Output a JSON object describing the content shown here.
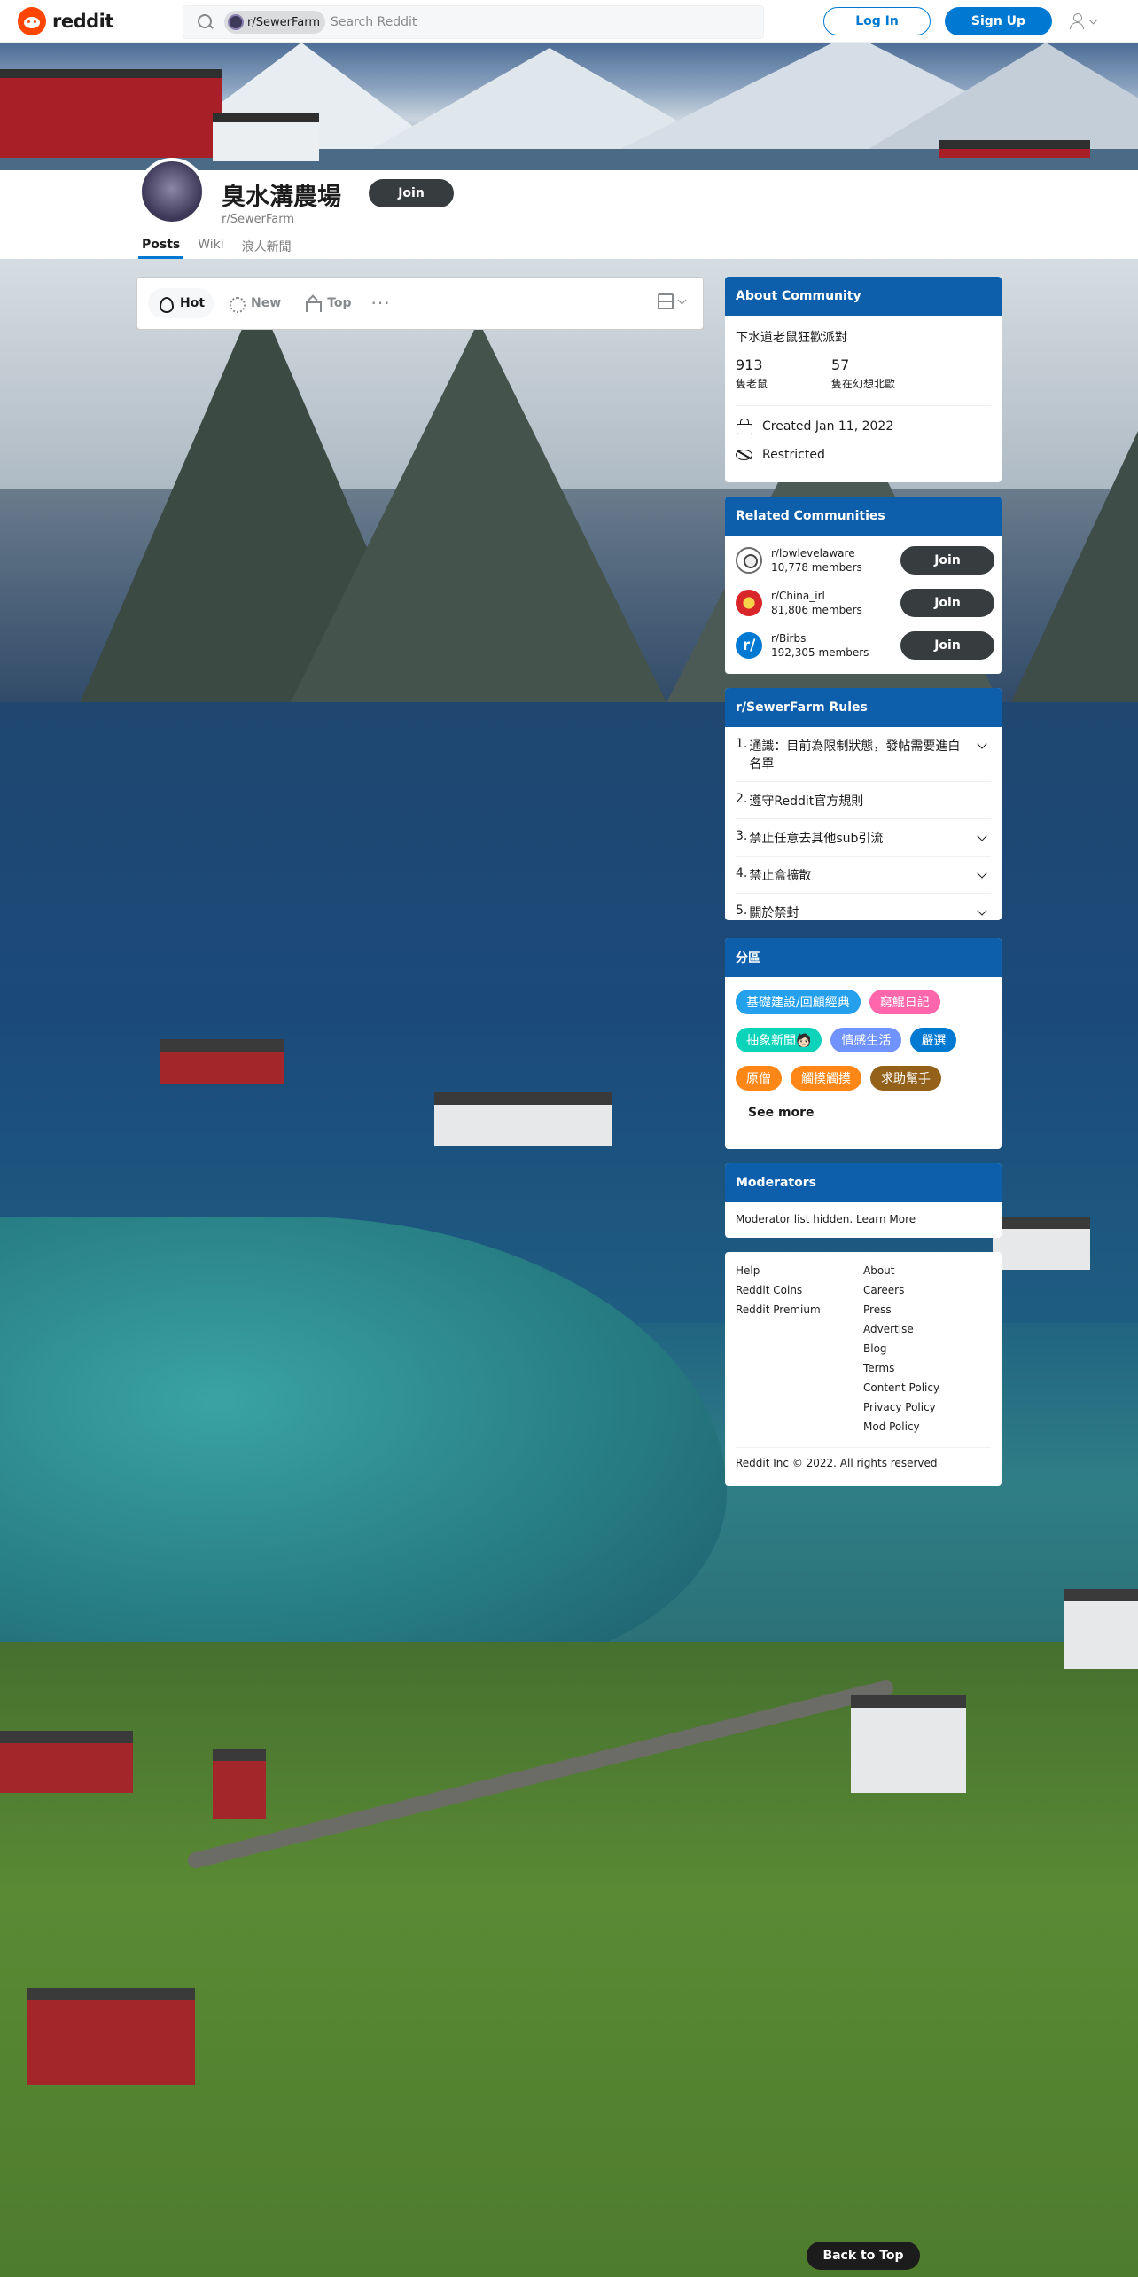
{
  "header": {
    "logo_text": "reddit",
    "search_chip": "r/SewerFarm",
    "search_placeholder": "Search Reddit",
    "login_label": "Log In",
    "signup_label": "Sign Up"
  },
  "community": {
    "title": "臭水溝農場",
    "subtitle": "r/SewerFarm",
    "join_label": "Join",
    "tabs": [
      {
        "label": "Posts",
        "active": true
      },
      {
        "label": "Wiki",
        "active": false
      },
      {
        "label": "浪人新聞",
        "active": false
      }
    ]
  },
  "sort": {
    "hot": "Hot",
    "new": "New",
    "top": "Top",
    "more": "···"
  },
  "about": {
    "heading": "About Community",
    "description": "下水道老鼠狂歡派對",
    "members_count": "913",
    "members_label": "隻老鼠",
    "online_count": "57",
    "online_label": "隻在幻想北歐",
    "created": "Created Jan 11, 2022",
    "restricted": "Restricted"
  },
  "related": {
    "heading": "Related Communities",
    "items": [
      {
        "name": "r/lowlevelaware",
        "members": "10,778 members",
        "join": "Join"
      },
      {
        "name": "r/China_irl",
        "members": "81,806 members",
        "join": "Join"
      },
      {
        "name": "r/Birbs",
        "members": "192,305 members",
        "join": "Join",
        "avatar_letter": "r/"
      }
    ]
  },
  "rules": {
    "heading": "r/SewerFarm Rules",
    "items": [
      {
        "num": "1.",
        "text": "通識：目前為限制狀態，發帖需要進白名單",
        "expandable": true
      },
      {
        "num": "2.",
        "text": "遵守Reddit官方規則",
        "expandable": false
      },
      {
        "num": "3.",
        "text": "禁止任意去其他sub引流",
        "expandable": true
      },
      {
        "num": "4.",
        "text": "禁止盒擴散",
        "expandable": true
      },
      {
        "num": "5.",
        "text": "關於禁封",
        "expandable": true
      }
    ]
  },
  "flair": {
    "heading": "分區",
    "items": [
      {
        "label": "基礎建設/回顧經典",
        "color": "#24a0ed"
      },
      {
        "label": "窮鯤日記",
        "color": "#ff66ac"
      },
      {
        "label": "抽象新聞🧑🏻",
        "color": "#0dd3bb"
      },
      {
        "label": "情感生活",
        "color": "#7193ff"
      },
      {
        "label": "嚴選",
        "color": "#0079d3"
      },
      {
        "label": "原僧",
        "color": "#ff8717"
      },
      {
        "label": "觸摸觸摸",
        "color": "#ff8717"
      },
      {
        "label": "求助幫手",
        "color": "#94611b"
      }
    ],
    "see_more": "See more"
  },
  "moderators": {
    "heading": "Moderators",
    "text": "Moderator list hidden.",
    "link": "Learn More"
  },
  "footer": {
    "col1": [
      "Help",
      "Reddit Coins",
      "Reddit Premium"
    ],
    "col2": [
      "About",
      "Careers",
      "Press",
      "Advertise",
      "Blog",
      "Terms",
      "Content Policy",
      "Privacy Policy",
      "Mod Policy"
    ],
    "copyright": "Reddit Inc © 2022. All rights reserved"
  },
  "back_to_top": "Back to Top"
}
